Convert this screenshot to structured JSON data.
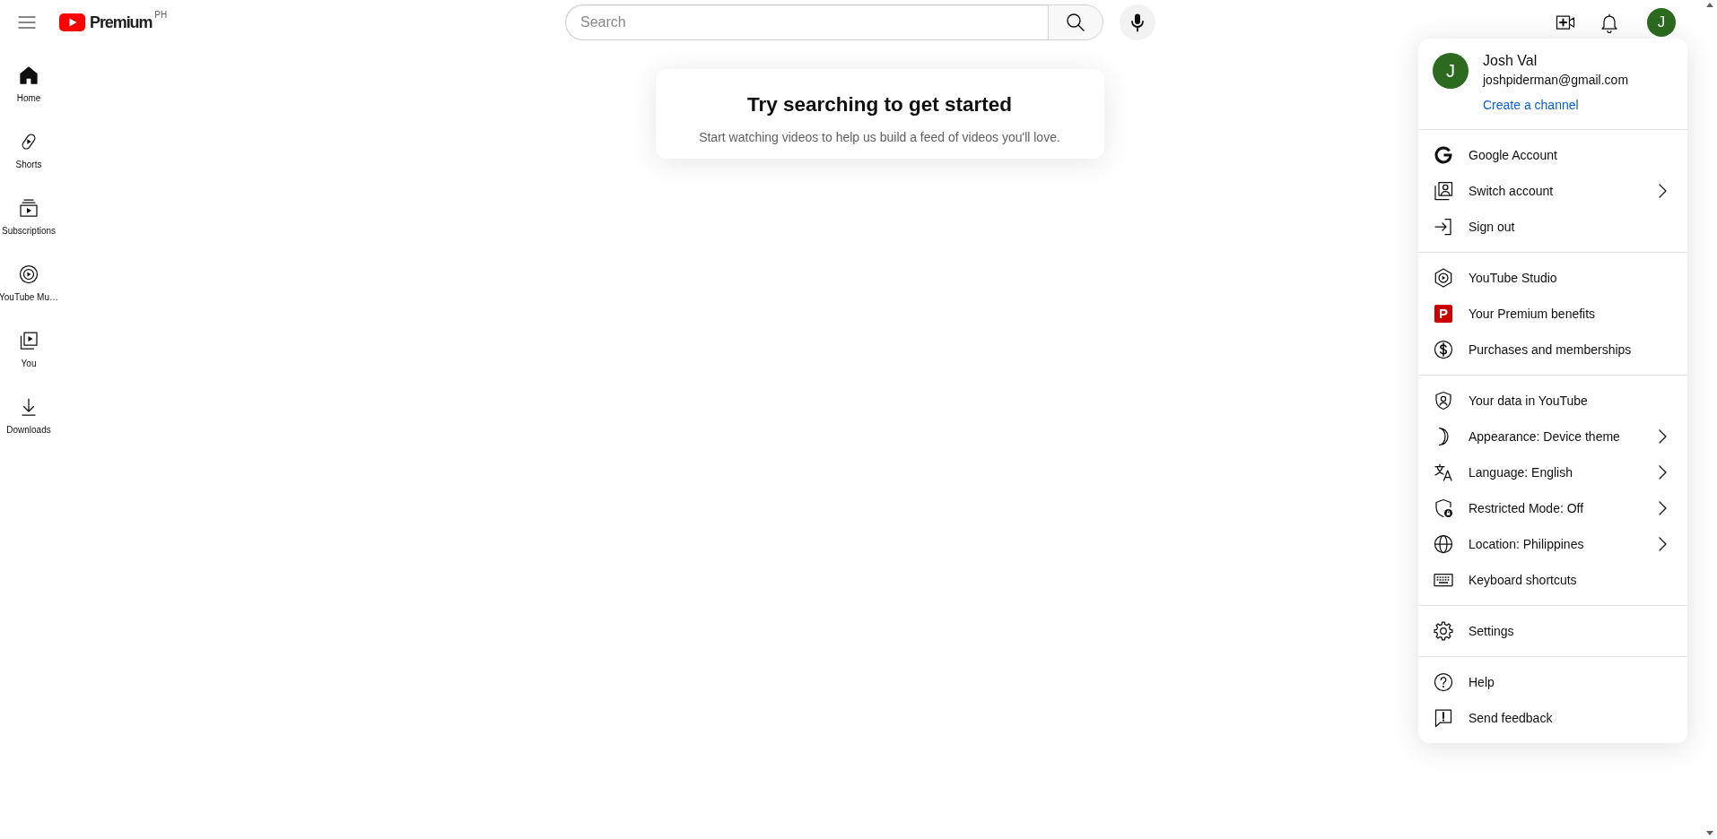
{
  "masthead": {
    "logo_text": "Premium",
    "country_code": "PH",
    "search": {
      "placeholder": "Search"
    },
    "avatar_letter": "J"
  },
  "sidebar": {
    "items": [
      {
        "label": "Home",
        "selected": true
      },
      {
        "label": "Shorts",
        "selected": false
      },
      {
        "label": "Subscriptions",
        "selected": false
      },
      {
        "label": "YouTube Mu…",
        "selected": false
      },
      {
        "label": "You",
        "selected": false
      },
      {
        "label": "Downloads",
        "selected": false
      }
    ]
  },
  "prompt_card": {
    "title": "Try searching to get started",
    "subtitle": "Start watching videos to help us build a feed of videos you'll love."
  },
  "account_menu": {
    "avatar_letter": "J",
    "name": "Josh Val",
    "email": "joshpiderman@gmail.com",
    "link": "Create a channel",
    "sections": [
      {
        "items": [
          {
            "label": "Google Account",
            "submenu": false
          },
          {
            "label": "Switch account",
            "submenu": true
          },
          {
            "label": "Sign out",
            "submenu": false
          }
        ]
      },
      {
        "items": [
          {
            "label": "YouTube Studio",
            "submenu": false
          },
          {
            "label": "Your Premium benefits",
            "submenu": false,
            "badge": "P"
          },
          {
            "label": "Purchases and memberships",
            "submenu": false
          }
        ]
      },
      {
        "items": [
          {
            "label": "Your data in YouTube",
            "submenu": false
          },
          {
            "label": "Appearance: Device theme",
            "submenu": true
          },
          {
            "label": "Language: English",
            "submenu": true
          },
          {
            "label": "Restricted Mode: Off",
            "submenu": true
          },
          {
            "label": "Location: Philippines",
            "submenu": true
          },
          {
            "label": "Keyboard shortcuts",
            "submenu": false
          }
        ]
      },
      {
        "items": [
          {
            "label": "Settings",
            "submenu": false
          }
        ]
      },
      {
        "items": [
          {
            "label": "Help",
            "submenu": false
          },
          {
            "label": "Send feedback",
            "submenu": false
          }
        ]
      }
    ]
  }
}
